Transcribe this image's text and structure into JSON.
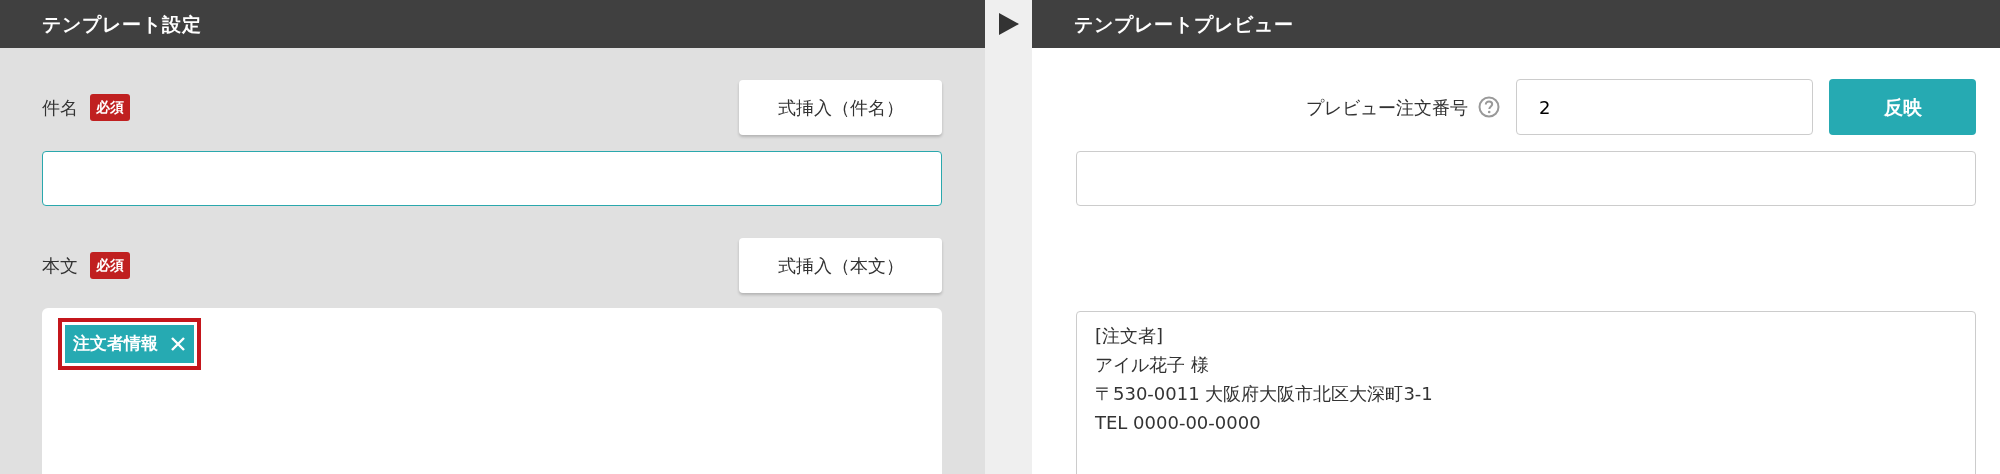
{
  "left_panel": {
    "title": "テンプレート設定",
    "fields": [
      {
        "label": "件名",
        "required_badge": "必須",
        "insert_button": "式挿入（件名）",
        "kind": "input"
      },
      {
        "label": "本文",
        "required_badge": "必須",
        "insert_button": "式挿入（本文）",
        "kind": "editor",
        "tags": [
          {
            "label": "注文者情報",
            "selected": true
          }
        ]
      }
    ]
  },
  "right_panel": {
    "title": "テンプレートプレビュー",
    "order_number": {
      "label": "プレビュー注文番号",
      "value": "2",
      "button": "反映"
    },
    "preview_lines": [
      "[注文者]",
      "アイル花子 様",
      "〒530-0011 大阪府大阪市北区大深町3-1",
      "TEL 0000-00-0000"
    ]
  }
}
